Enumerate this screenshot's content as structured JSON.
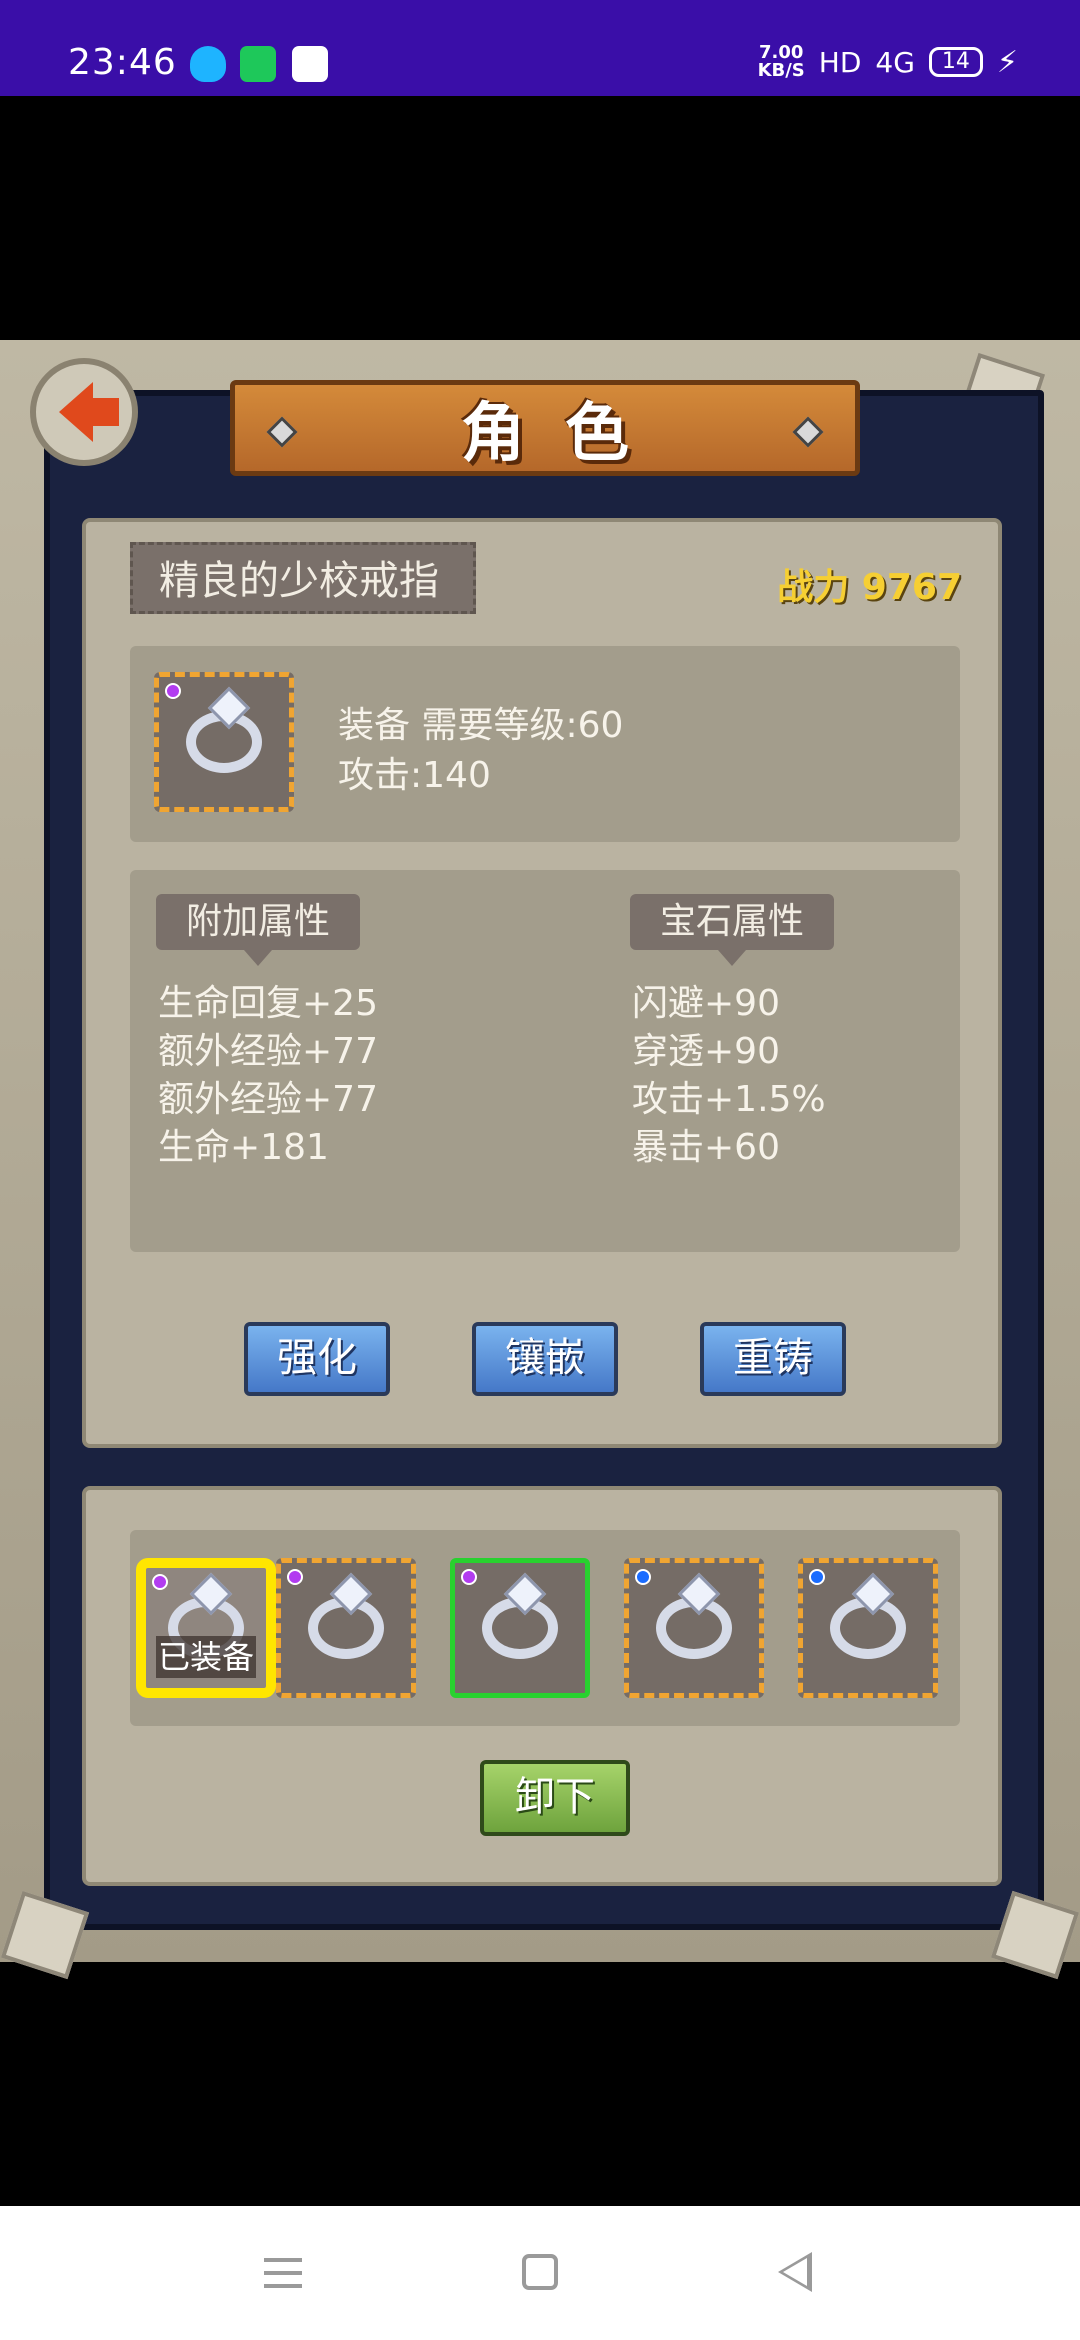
{
  "status_bar": {
    "time": "23:46",
    "net_speed_value": "7.00",
    "net_speed_unit": "KB/S",
    "hd": "HD",
    "network": "4G",
    "battery": "14"
  },
  "header": {
    "title": "角色"
  },
  "item": {
    "name": "精良的少校戒指",
    "power_label": "战力",
    "power_value": "9767",
    "line1": "装备  需要等级:60",
    "line2": "攻击:140"
  },
  "attributes": {
    "extra_label": "附加属性",
    "extra": [
      "生命回复+25",
      "额外经验+77",
      "额外经验+77",
      "生命+181"
    ],
    "gem_label": "宝石属性",
    "gem": [
      "闪避+90",
      "穿透+90",
      "攻击+1.5%",
      "暴击+60"
    ]
  },
  "actions": {
    "strengthen": "强化",
    "inlay": "镶嵌",
    "recast": "重铸"
  },
  "inventory": {
    "equipped_label": "已装备",
    "unequip": "卸下",
    "gem_colors": [
      "#b23cf0",
      "#b23cf0",
      "#b23cf0",
      "#1a6cff",
      "#1a6cff"
    ]
  },
  "icons": {
    "back": "back-arrow-icon",
    "ring": "ring-icon",
    "nav_menu": "menu-icon",
    "nav_home": "home-icon",
    "nav_back": "back-icon"
  }
}
